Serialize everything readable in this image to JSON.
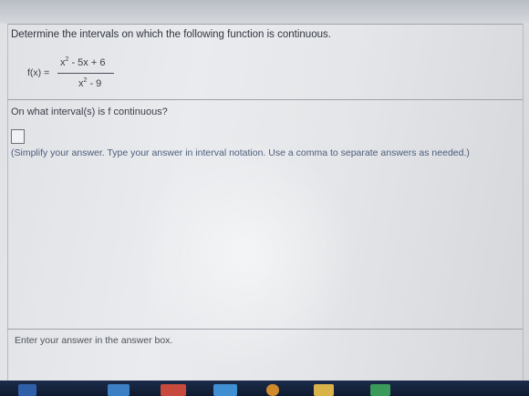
{
  "question": {
    "instruction": "Determine the intervals on which the following function is continuous.",
    "function_label": "f(x) =",
    "numerator": {
      "base": "x",
      "exp": "2",
      "rest": " - 5x + 6"
    },
    "denominator": {
      "base": "x",
      "exp": "2",
      "rest": " - 9"
    },
    "prompt": "On what interval(s) is f continuous?"
  },
  "answer": {
    "hint": "(Simplify your answer. Type your answer in interval notation. Use a comma to separate answers as needed.)"
  },
  "footer": {
    "message": "Enter your answer in the answer box."
  },
  "taskbar": {
    "icons": [
      "windows-start-icon",
      "app-icon-blue",
      "app-icon-red",
      "app-icon-blue-2",
      "app-icon-orange",
      "folder-icon",
      "app-icon-green"
    ]
  }
}
